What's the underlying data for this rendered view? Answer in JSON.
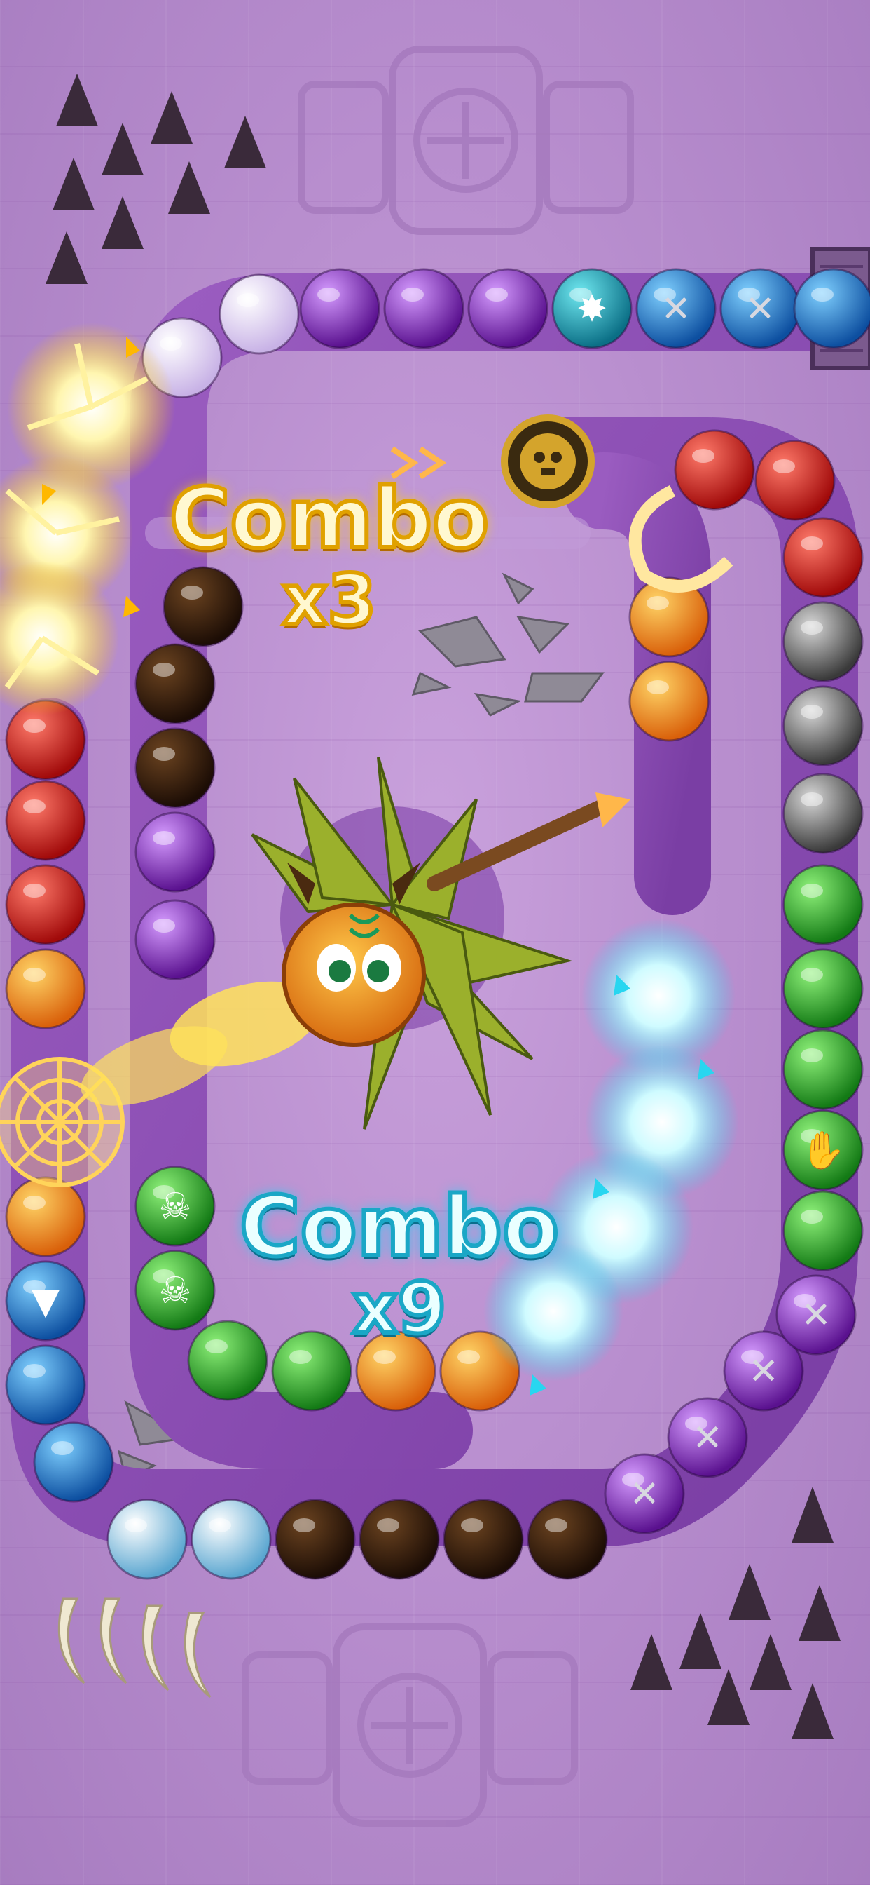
{
  "colors": {
    "background": "#b98fcf",
    "track": "#8a4fb0",
    "combo_gold": "#e0a100",
    "combo_cyan": "#1aa7c6"
  },
  "combos": [
    {
      "word": "Combo",
      "multiplier": "x3",
      "style": "gold"
    },
    {
      "word": "Combo",
      "multiplier": "x9",
      "style": "cyan"
    }
  ],
  "shooter": {
    "name": "dragon-shooter",
    "color": "#f39a1e"
  },
  "ball_types": {
    "white": "#f2e8ff",
    "purple": "#8c2fd6",
    "blue": "#2b8fe0",
    "teal": "#1aa8b8",
    "red": "#e01c1c",
    "orange": "#f59a10",
    "gray": "#6d6d6d",
    "green": "#2fae2b",
    "lava": "#3a2010",
    "ice": "#a8d8f0"
  },
  "icons": [
    "skull-icon",
    "hand-icon",
    "chain-icon",
    "star-icon",
    "web-icon",
    "skull-coin-icon"
  ]
}
